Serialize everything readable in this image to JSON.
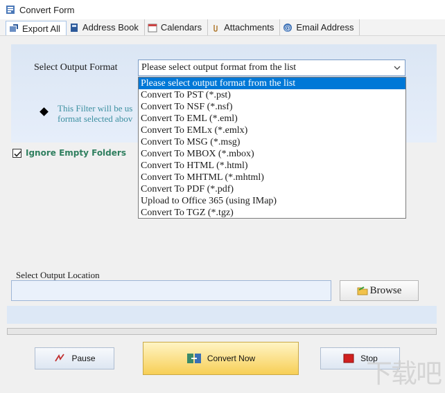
{
  "window": {
    "title": "Convert Form"
  },
  "tabs": [
    {
      "label": "Export All",
      "icon": "export-icon",
      "active": true
    },
    {
      "label": "Address Book",
      "icon": "address-book-icon",
      "active": false
    },
    {
      "label": "Calendars",
      "icon": "calendar-icon",
      "active": false
    },
    {
      "label": "Attachments",
      "icon": "attachment-icon",
      "active": false
    },
    {
      "label": "Email Address",
      "icon": "at-icon",
      "active": false
    }
  ],
  "format": {
    "label": "Select Output Format",
    "selected": "Please select output format from the list",
    "note": "This Filter will be us\nformat selected abov",
    "options": [
      "Please select output format from the list",
      "Convert To PST (*.pst)",
      "Convert To NSF (*.nsf)",
      "Convert To EML (*.eml)",
      "Convert To EMLx (*.emlx)",
      "Convert To MSG (*.msg)",
      "Convert To MBOX (*.mbox)",
      "Convert To HTML (*.html)",
      "Convert To MHTML (*.mhtml)",
      "Convert To PDF (*.pdf)",
      "Upload to Office 365 (using IMap)",
      "Convert To TGZ (*.tgz)"
    ],
    "highlighted_index": 0
  },
  "ignore_empty": {
    "label": "Ignore Empty Folders",
    "checked": true
  },
  "location": {
    "label": "Select Output Location",
    "value": ""
  },
  "buttons": {
    "browse": "Browse",
    "pause": "Pause",
    "convert": "Convert Now",
    "stop": "Stop"
  },
  "progress": 0,
  "colors": {
    "accent": "#0078d7",
    "panel": "#dbe6f4",
    "convert_button": "#f7cf56",
    "note_text": "#3b8fa0",
    "checkbox_label": "#2f7f5f"
  },
  "watermark": "下载吧"
}
